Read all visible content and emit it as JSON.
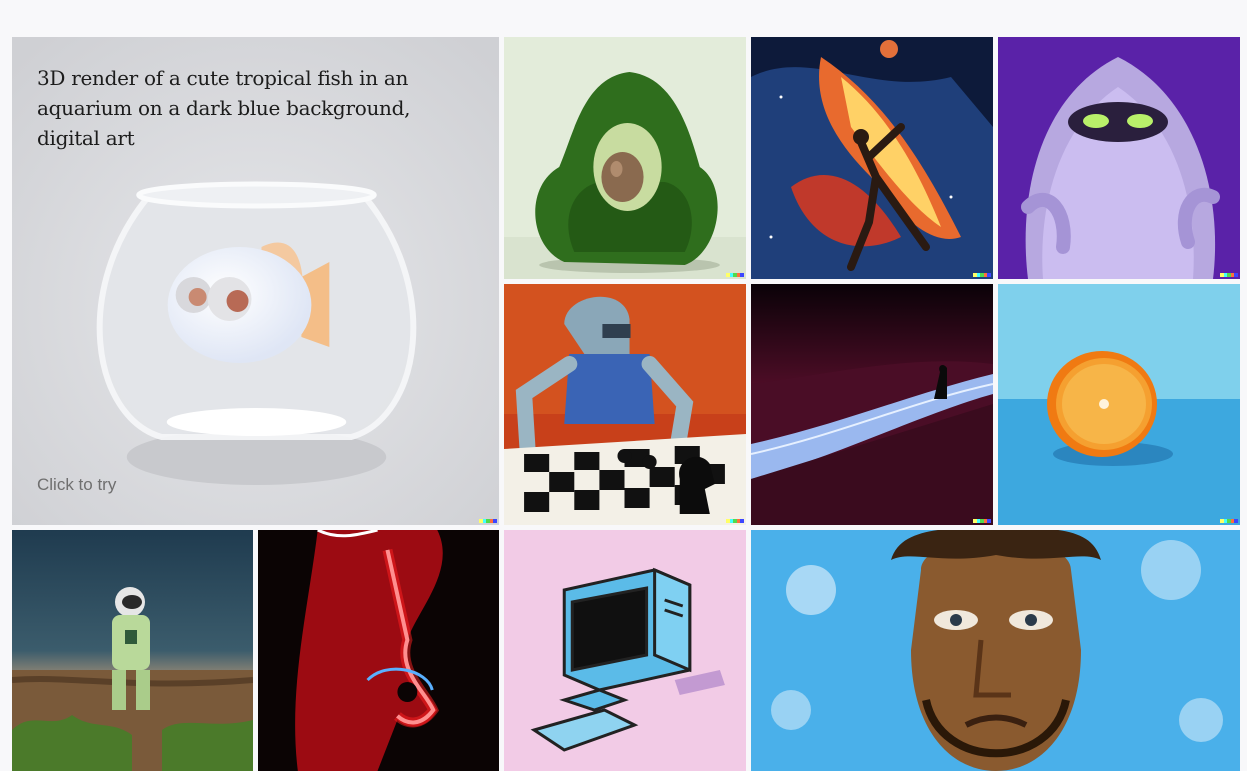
{
  "feature": {
    "prompt": "3D render of a cute tropical fish in an aquarium on a dark blue background, digital art",
    "cta": "Click to try"
  },
  "colors": {
    "page_background": "#f8f8fa",
    "feature_background": "#dcdde0",
    "prompt_text": "#1c1c1c",
    "cta_text": "#6f6f6f"
  },
  "watermark": {
    "colors": [
      "#ffff66",
      "#42ffff",
      "#51da4c",
      "#ff6e3c",
      "#3c46ff"
    ]
  }
}
